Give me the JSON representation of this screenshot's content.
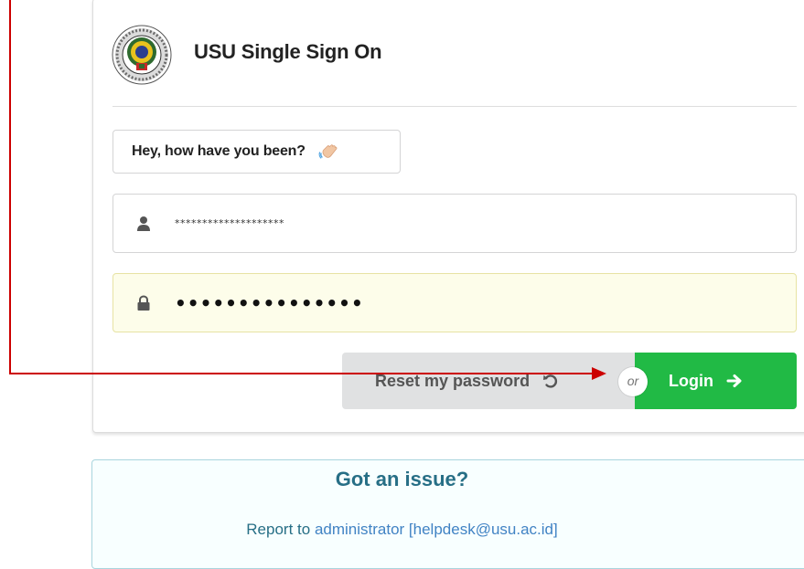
{
  "card": {
    "title": "USU Single Sign On",
    "logo_icon": "usu-seal-logo"
  },
  "greeting": {
    "text": "Hey, how have you been?",
    "icon": "waving-hand-icon"
  },
  "username": {
    "value": "********************",
    "icon": "user-icon"
  },
  "password": {
    "value": "•••••••••••••••",
    "icon": "lock-icon"
  },
  "actions": {
    "reset_label": "Reset my password",
    "reset_icon": "undo-icon",
    "or_label": "or",
    "login_label": "Login",
    "login_icon": "arrow-right-icon"
  },
  "info": {
    "title": "Got an issue?",
    "prefix": "Report to ",
    "link_text": "administrator [helpdesk@usu.ac.id]"
  },
  "colors": {
    "login_green": "#21ba45",
    "reset_gray": "#e0e1e2",
    "info_text": "#276f86",
    "info_link": "#4183c4",
    "password_bg": "#fdfdea",
    "annotation_red": "#cc0000"
  }
}
